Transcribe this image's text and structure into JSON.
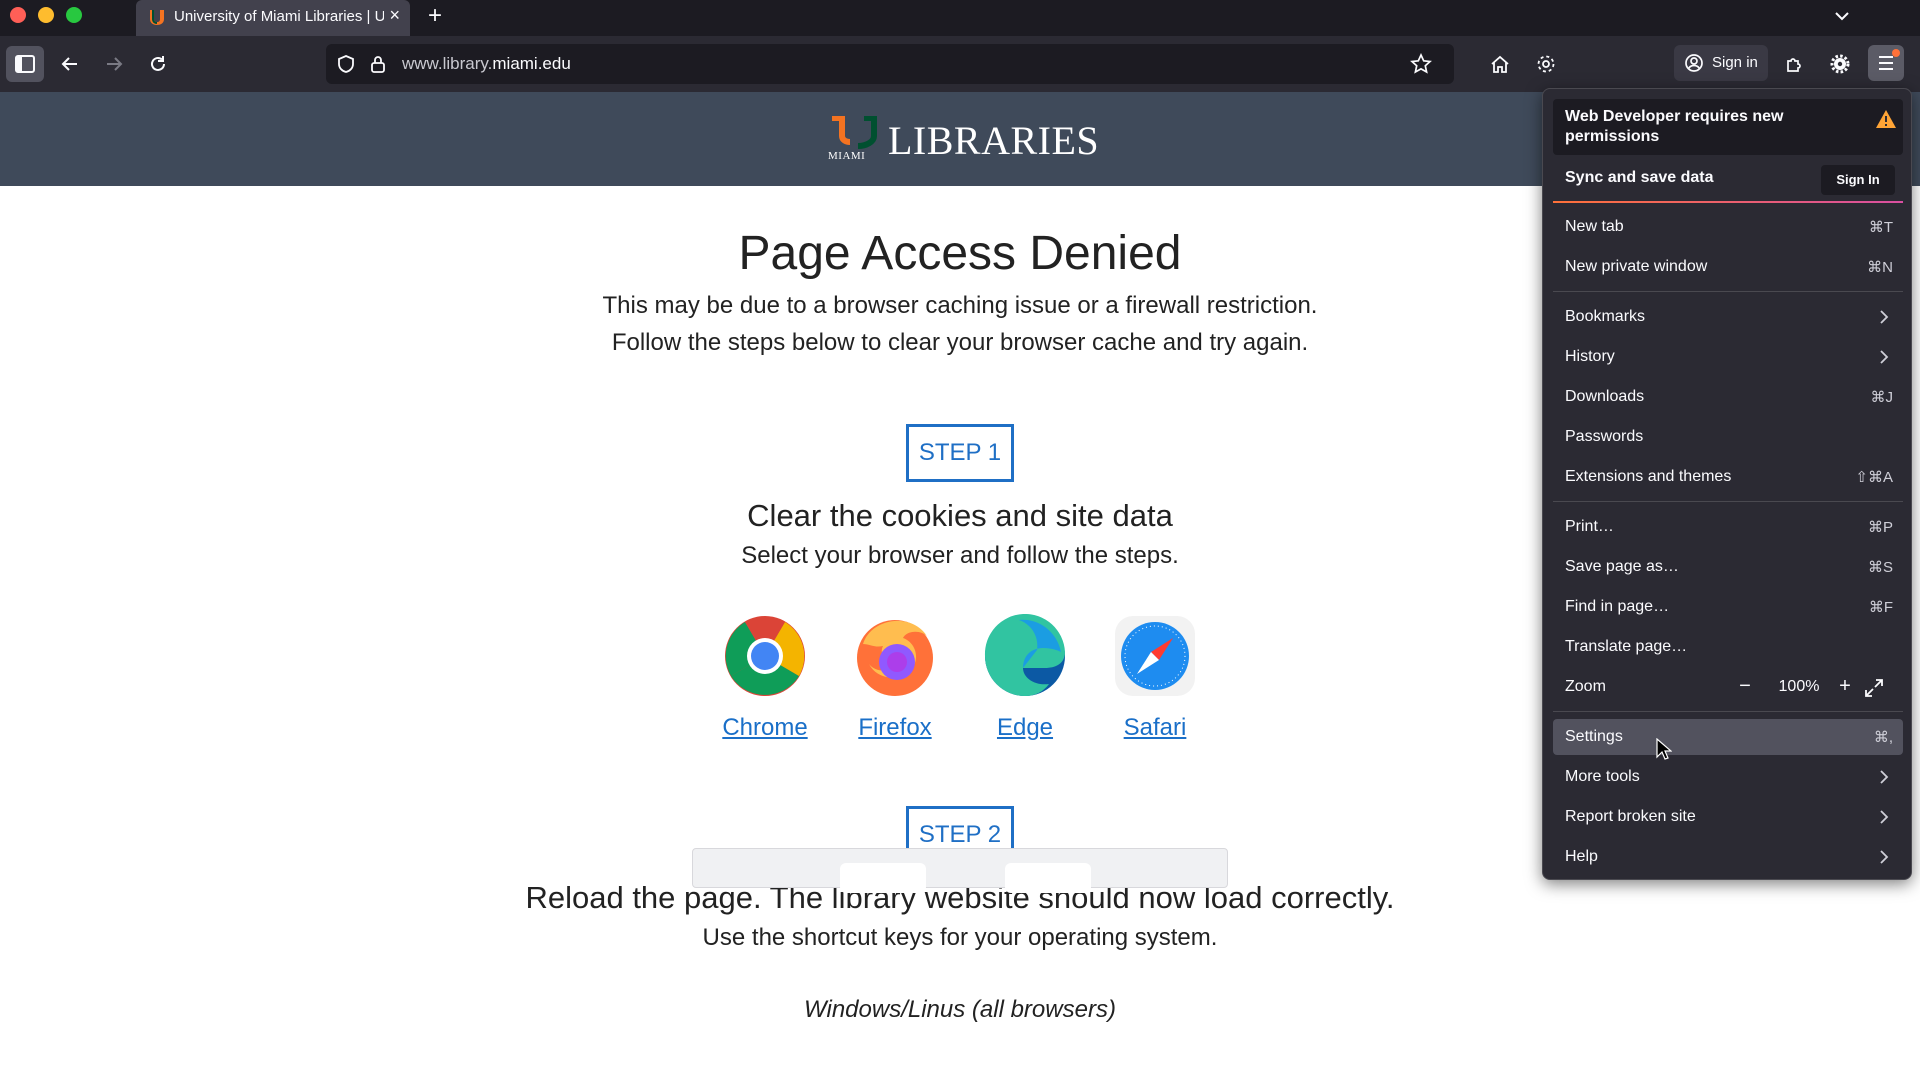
{
  "browser": {
    "tab_title": "University of Miami Libraries | U",
    "url_host_prefix": "www.library.",
    "url_host_domain": "miami.edu",
    "signin_label": "Sign in",
    "colors": {
      "chrome_bg": "#1c1b22",
      "toolbar_bg": "#2b2a33",
      "accent_orange": "#ff7139"
    }
  },
  "site": {
    "logo_text": "LIBRARIES",
    "logo_sub": "MIAMI",
    "header_bg": "#3f4a5a"
  },
  "main": {
    "title": "Page Access Denied",
    "intro_line1": "This may be due to a browser caching issue or a firewall restriction.",
    "intro_line2": "Follow the steps below to clear your browser cache and try again.",
    "step1_label": "STEP 1",
    "step1_heading": "Clear the cookies and site data",
    "step1_sub": "Select your browser and follow the steps.",
    "browsers": [
      {
        "name": "Chrome",
        "icon": "chrome-icon"
      },
      {
        "name": "Firefox",
        "icon": "firefox-icon"
      },
      {
        "name": "Edge",
        "icon": "edge-icon"
      },
      {
        "name": "Safari",
        "icon": "safari-icon"
      }
    ],
    "step2_label": "STEP 2",
    "step2_heading": "Reload the page. The library website should now load correctly.",
    "step2_sub": "Use the shortcut keys for your operating system.",
    "windows_label": "Windows/Linus (all browsers)",
    "link_color": "#1a6fc8"
  },
  "menu": {
    "banner_text": "Web Developer requires new permissions",
    "sync_label": "Sync and save data",
    "sync_button": "Sign In",
    "items": [
      {
        "label": "New tab",
        "shortcut": "⌘T"
      },
      {
        "label": "New private window",
        "shortcut": "⌘N"
      },
      {
        "label": "Bookmarks",
        "shortcut": ""
      },
      {
        "label": "History",
        "shortcut": ""
      },
      {
        "label": "Downloads",
        "shortcut": "⌘J"
      },
      {
        "label": "Passwords",
        "shortcut": ""
      },
      {
        "label": "Extensions and themes",
        "shortcut": "⇧⌘A"
      },
      {
        "label": "Print…",
        "shortcut": "⌘P"
      },
      {
        "label": "Save page as…",
        "shortcut": "⌘S"
      },
      {
        "label": "Find in page…",
        "shortcut": "⌘F"
      },
      {
        "label": "Translate page…",
        "shortcut": ""
      },
      {
        "label": "Zoom",
        "shortcut": ""
      },
      {
        "label": "Settings",
        "shortcut": "⌘,"
      },
      {
        "label": "More tools",
        "shortcut": ""
      },
      {
        "label": "Report broken site",
        "shortcut": ""
      },
      {
        "label": "Help",
        "shortcut": ""
      }
    ],
    "zoom_value": "100%",
    "zoom_minus": "−",
    "zoom_plus": "+"
  }
}
